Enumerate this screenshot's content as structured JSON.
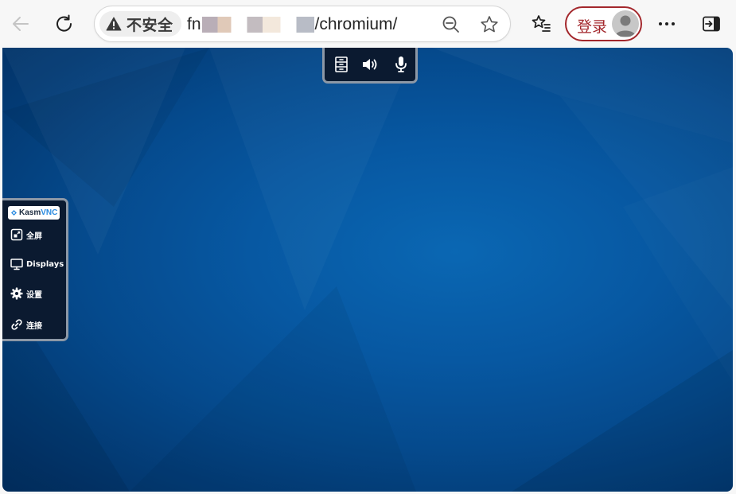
{
  "browser": {
    "security_label": "不安全",
    "url_prefix": "fn",
    "url_suffix": "/chromium/",
    "login_label": "登录"
  },
  "vnc": {
    "top_controls": [
      {
        "name": "clipboard-icon"
      },
      {
        "name": "speaker-icon"
      },
      {
        "name": "microphone-icon"
      }
    ],
    "brand_part1": "Kasm",
    "brand_part2": "VNC",
    "menu": [
      {
        "label": "全屏",
        "icon": "fullscreen-icon"
      },
      {
        "label": "Displays",
        "icon": "monitor-icon"
      },
      {
        "label": "设置",
        "icon": "gear-icon"
      },
      {
        "label": "连接",
        "icon": "link-icon"
      }
    ]
  },
  "colors": {
    "accent_login": "#a3272c",
    "desktop_blue": "#0758a2",
    "panel_bg": "#0b1a30"
  }
}
